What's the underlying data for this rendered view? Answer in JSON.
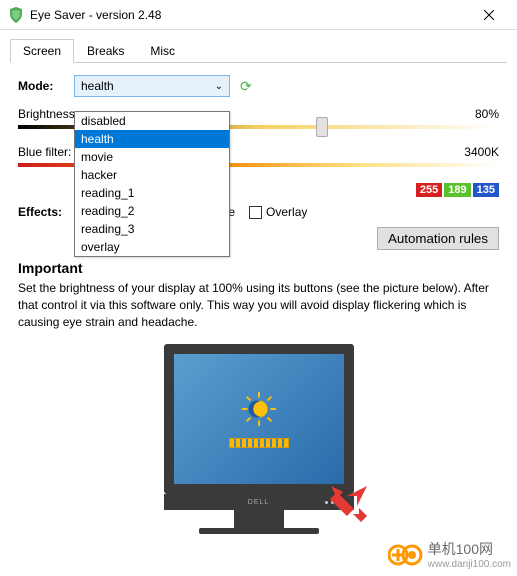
{
  "window": {
    "title": "Eye Saver - version 2.48"
  },
  "tabs": {
    "screen": "Screen",
    "breaks": "Breaks",
    "misc": "Misc"
  },
  "mode": {
    "label": "Mode:",
    "value": "health",
    "options": [
      "disabled",
      "health",
      "movie",
      "hacker",
      "reading_1",
      "reading_2",
      "reading_3",
      "overlay"
    ]
  },
  "brightness": {
    "label": "Brightness:",
    "value": "80%",
    "pos": 62
  },
  "bluefilter": {
    "label": "Blue filter:",
    "value": "3400K",
    "pos": 38
  },
  "rgb": {
    "r": "255",
    "g": "189",
    "b": "135"
  },
  "effects": {
    "label": "Effects:",
    "grayscale": "Grayscale",
    "overlay": "Overlay"
  },
  "automation": {
    "button": "Automation rules"
  },
  "important": {
    "heading": "Important",
    "body": "Set the brightness of your display at 100% using its buttons (see the picture below). After that control it via this software only. This way you will avoid display flickering which is causing eye strain and headache."
  },
  "monitor": {
    "brand": "DELL"
  },
  "watermark": {
    "text": "单机100网",
    "url": "www.danji100.com"
  }
}
